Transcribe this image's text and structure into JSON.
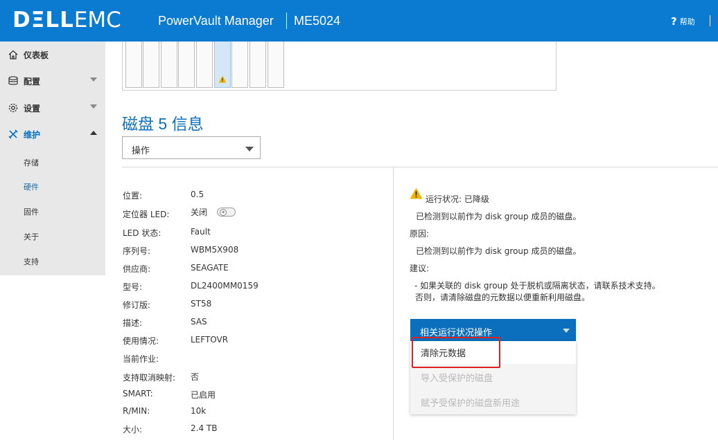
{
  "header": {
    "logo_dell": "DΞLL",
    "logo_emc": "EMC",
    "app_name": "PowerVault Manager",
    "model": "ME5024",
    "help_label": "帮助"
  },
  "sidebar": {
    "items": [
      {
        "label": "仪表板",
        "icon": "home-icon"
      },
      {
        "label": "配置",
        "icon": "database-icon"
      },
      {
        "label": "设置",
        "icon": "gear-icon"
      },
      {
        "label": "维护",
        "icon": "tools-icon"
      }
    ],
    "subitems": [
      {
        "label": "存储"
      },
      {
        "label": "硬件"
      },
      {
        "label": "固件"
      },
      {
        "label": "关于"
      },
      {
        "label": "支持"
      }
    ]
  },
  "disk": {
    "title": "磁盘 5 信息",
    "action_label": "操作",
    "properties": [
      {
        "label": "位置:",
        "value": "0.5"
      },
      {
        "label": "定位器 LED:",
        "value": "关闭"
      },
      {
        "label": "LED 状态:",
        "value": "Fault"
      },
      {
        "label": "序列号:",
        "value": "WBM5X908"
      },
      {
        "label": "供应商:",
        "value": "SEAGATE"
      },
      {
        "label": "型号:",
        "value": "DL2400MM0159"
      },
      {
        "label": "修订版:",
        "value": "ST58"
      },
      {
        "label": "描述:",
        "value": "SAS"
      },
      {
        "label": "使用情况:",
        "value": "LEFTOVR"
      },
      {
        "label": "当前作业:",
        "value": ""
      },
      {
        "label": "支持取消映射:",
        "value": "否"
      },
      {
        "label": "SMART:",
        "value": "已启用"
      },
      {
        "label": "R/MIN:",
        "value": "10k"
      },
      {
        "label": "大小:",
        "value": "2.4 TB"
      }
    ]
  },
  "health": {
    "status": "运行状况: 已降级",
    "status_detail": "已检测到以前作为 disk group 成员的磁盘。",
    "reason_label": "原因:",
    "reason_text": "已检测到以前作为 disk group 成员的磁盘。",
    "recommend_label": "建议:",
    "recommend_line1": "- 如果关联的 disk group 处于脱机或隔离状态，请联系技术支持。",
    "recommend_line2": "否则，请清除磁盘的元数据以便重新利用磁盘。",
    "actions_label": "相关运行状况操作",
    "menu": [
      {
        "label": "清除元数据",
        "enabled": true
      },
      {
        "label": "导入受保护的磁盘",
        "enabled": false
      },
      {
        "label": "赋予受保护的磁盘新用途",
        "enabled": false
      }
    ]
  },
  "colors": {
    "brand_blue": "#0b7bd1",
    "accent_blue": "#0b6fbd",
    "warning": "#f0b400",
    "highlight_red": "#e02020"
  }
}
